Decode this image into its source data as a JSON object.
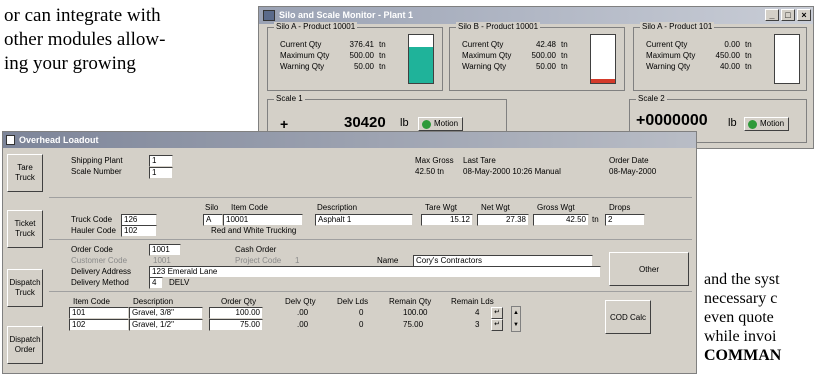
{
  "page_text": {
    "top_left": [
      "or can integrate with",
      "other modules allow-",
      "ing your growing"
    ],
    "right_lines": [
      "and the syst",
      "necessary c",
      "even quote",
      "while invoi",
      "COMMAN"
    ]
  },
  "silo_window": {
    "title": "Silo and Scale Monitor - Plant 1",
    "btn_min": "_",
    "btn_max": "□",
    "btn_close": "×",
    "panels": [
      {
        "title": "Silo A - Product 10001",
        "current_label": "Current Qty",
        "current": "376.41",
        "max_label": "Maximum Qty",
        "max": "500.00",
        "warn_label": "Warning Qty",
        "warn": "50.00",
        "unit": "tn",
        "fill_fraction": 0.75,
        "fill_color": "#1fb39a"
      },
      {
        "title": "Silo B - Product 10001",
        "current_label": "Current Qty",
        "current": "42.48",
        "max_label": "Maximum Qty",
        "max": "500.00",
        "warn_label": "Warning Qty",
        "warn": "50.00",
        "unit": "tn",
        "fill_fraction": 0.08,
        "fill_color": "#d43a2a"
      },
      {
        "title": "Silo A - Product 101",
        "current_label": "Current Qty",
        "current": "0.00",
        "max_label": "Maximum Qty",
        "max": "450.00",
        "warn_label": "Warning Qty",
        "warn": "40.00",
        "unit": "tn",
        "fill_fraction": 0.0,
        "fill_color": "#1fb39a"
      }
    ],
    "scale1": {
      "title": "Scale 1",
      "sign": "+",
      "value": "30420",
      "unit": "lb",
      "motion": "Motion"
    },
    "scale2": {
      "title": "Scale 2",
      "value": "+0000000",
      "unit": "lb",
      "motion": "Motion"
    }
  },
  "loadout": {
    "title": "Overhead Loadout",
    "buttons": {
      "tare": "Tare Truck",
      "ticket": "Ticket Truck",
      "dispatch_truck": "Dispatch Truck",
      "dispatch_order": "Dispatch Order",
      "other": "Other",
      "cod": "COD Calc"
    },
    "shipping_plant_label": "Shipping Plant",
    "shipping_plant": "1",
    "scale_number_label": "Scale Number",
    "scale_number": "1",
    "max_gross_label": "Max Gross",
    "max_gross": "42.50 tn",
    "last_tare_label": "Last Tare",
    "last_tare": "08-May-2000 10:26  Manual",
    "order_date_label": "Order Date",
    "order_date": "08-May-2000",
    "silo_label": "Silo",
    "silo": "A",
    "item_code_label": "Item Code",
    "item_code": "10001",
    "description_label": "Description",
    "description": "Asphalt 1",
    "tare_wgt_label": "Tare Wgt",
    "tare_wgt": "15.12",
    "net_wgt_label": "Net Wgt",
    "net_wgt": "27.38",
    "gross_wgt_label": "Gross Wgt",
    "gross_wgt": "42.50",
    "gross_unit": "tn",
    "drops_label": "Drops",
    "drops": "2",
    "truck_code_label": "Truck Code",
    "truck_code": "126",
    "hauler_code_label": "Hauler Code",
    "hauler_code": "102",
    "hauler_name": "Red and White Trucking",
    "order_code_label": "Order Code",
    "order_code": "1001",
    "cash_order": "Cash Order",
    "customer_code_label": "Customer Code",
    "customer_code": "1001",
    "project_code_label": "Project Code",
    "project_code": "1",
    "name_label": "Name",
    "name": "Cory's Contractors",
    "delivery_address_label": "Delivery Address",
    "delivery_address": "123 Emerald Lane",
    "delivery_method_label": "Delivery Method",
    "delivery_method_code": "4",
    "delivery_method": "DELV",
    "grid_headers": [
      "Item Code",
      "Description",
      "Order Qty",
      "Delv Qty",
      "Delv Lds",
      "Remain Qty",
      "Remain Lds"
    ],
    "grid_rows": [
      {
        "item": "101",
        "desc": "Gravel, 3/8\"",
        "order_qty": "100.00",
        "delv_qty": ".00",
        "delv_lds": "0",
        "remain_qty": "100.00",
        "remain_lds": "4"
      },
      {
        "item": "102",
        "desc": "Gravel, 1/2\"",
        "order_qty": "75.00",
        "delv_qty": ".00",
        "delv_lds": "0",
        "remain_qty": "75.00",
        "remain_lds": "3"
      }
    ]
  }
}
